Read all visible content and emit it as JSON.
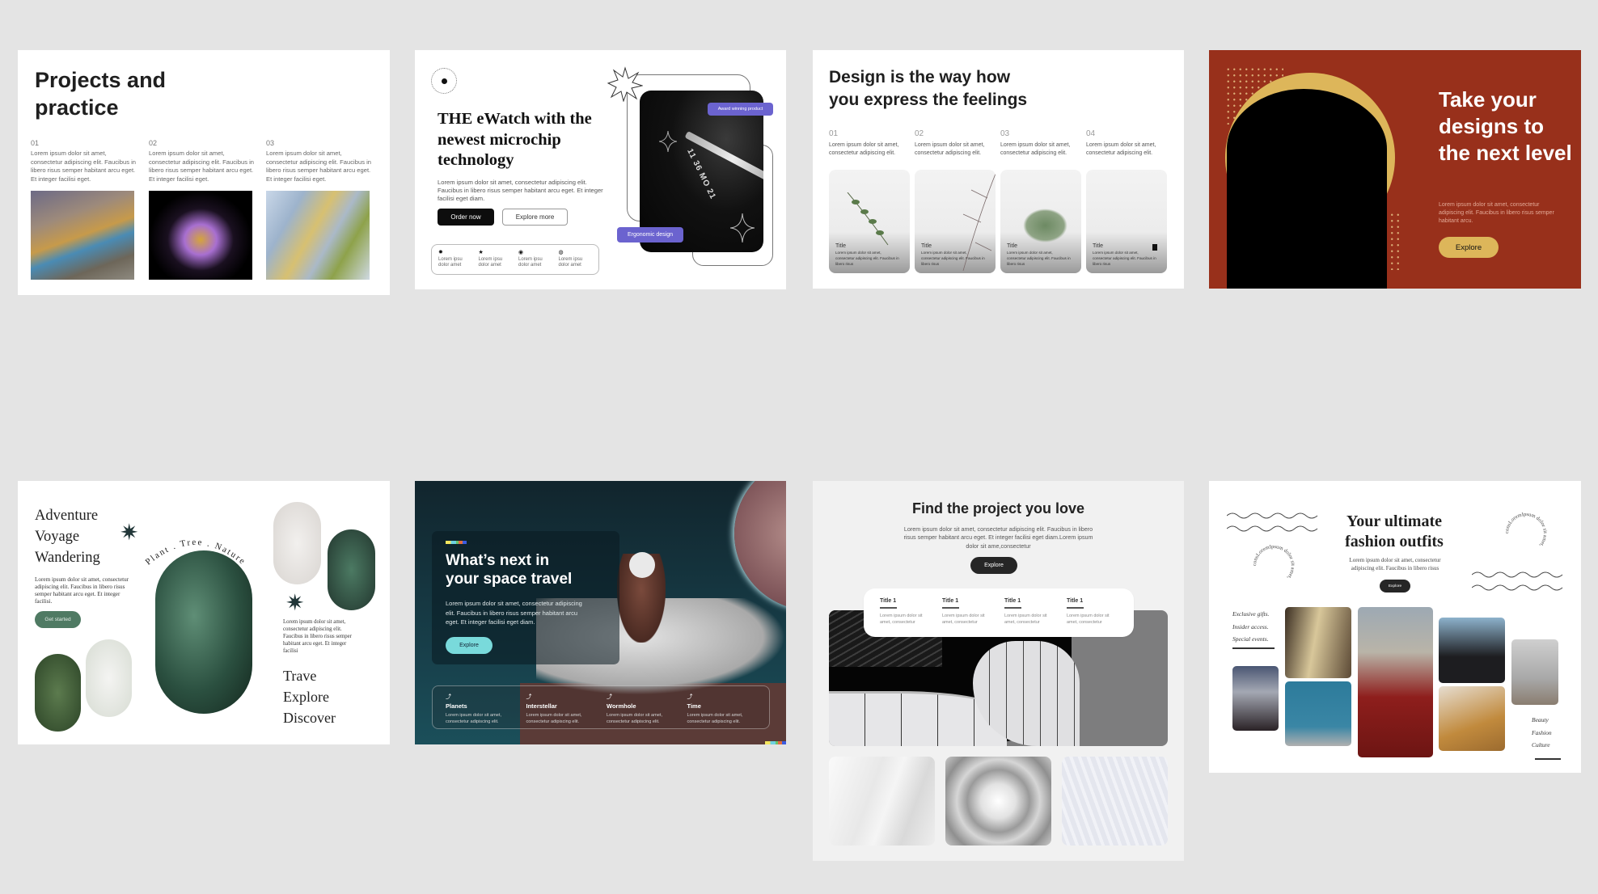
{
  "page": {
    "background": "#e4e4e4"
  },
  "cards": {
    "projects": {
      "title_line1": "Projects and",
      "title_line2": "practice",
      "columns": [
        {
          "number": "01",
          "text": "Lorem ipsum dolor sit amet, consectetur adipiscing elit. Faucibus in libero risus semper habitant arcu eget. Et integer facilisi eget.",
          "image": "iridescent-crumpled-foil"
        },
        {
          "number": "02",
          "text": "Lorem ipsum dolor sit amet, consectetur adipiscing elit. Faucibus in libero risus semper habitant arcu eget. Et integer facilisi eget.",
          "image": "crystal-hand-gold-ring"
        },
        {
          "number": "03",
          "text": "Lorem ipsum dolor sit amet, consectetur adipiscing elit. Faucibus in libero risus semper habitant arcu eget. Et integer facilisi eget.",
          "image": "crystal-shards"
        }
      ]
    },
    "ewatch": {
      "title": "THE eWatch with the newest microchip technology",
      "description": "Lorem ipsum dolor sit amet, consectetur adipiscing elit. Faucibus in libero risus semper habitant arcu eget. Et integer facilisi eget diam.",
      "order_button": "Order now",
      "explore_button": "Explore more",
      "award_tag": "Award winning product",
      "ergonomic_tag": "Ergonomic design",
      "watch_display": "11 36 MO 21",
      "features": [
        {
          "icon": "sun-icon",
          "glyph": "✹",
          "text": "Lorem ipsu dolor amet"
        },
        {
          "icon": "star-icon",
          "glyph": "★",
          "text": "Lorem ipsu dolor amet"
        },
        {
          "icon": "eye-icon",
          "glyph": "◉",
          "text": "Lorem ipsu dolor amet"
        },
        {
          "icon": "globe-icon",
          "glyph": "◍",
          "text": "Lorem ipsu dolor amet"
        }
      ],
      "accent": "#6b63cf"
    },
    "design": {
      "title_line1": "Design is the way how",
      "title_line2": "you express the feelings",
      "columns": [
        {
          "number": "01",
          "text": "Lorem ipsum dolor sit amet, consectetur adipiscing elit.",
          "tile_title": "Title",
          "tile_text": "Lorem ipsum dolor sit amet, consectetur adipiscing elit. Faucibus in libero risus"
        },
        {
          "number": "02",
          "text": "Lorem ipsum dolor sit amet, consectetur adipiscing elit.",
          "tile_title": "Title",
          "tile_text": "Lorem ipsum dolor sit amet, consectetur adipiscing elit. Faucibus in libero risus"
        },
        {
          "number": "03",
          "text": "Lorem ipsum dolor sit amet, consectetur adipiscing elit.",
          "tile_title": "Title",
          "tile_text": "Lorem ipsum dolor sit amet, consectetur adipiscing elit. Faucibus in libero risus"
        },
        {
          "number": "04",
          "text": "Lorem ipsum dolor sit amet, consectetur adipiscing elit.",
          "tile_title": "Title",
          "tile_text": "Lorem ipsum dolor sit amet, consectetur adipiscing elit. Faucibus in libero risus"
        }
      ]
    },
    "next_level": {
      "title": "Take your designs to the next level",
      "description": "Lorem ipsum dolor sit amet, consectetur adipiscing elit. Faucibus in libero risus semper habitant arcu.",
      "button": "Explore",
      "background": "#98301b",
      "accent": "#ddb65a"
    },
    "adventure": {
      "title_lines": [
        "Adventure",
        "Voyage",
        "Wandering"
      ],
      "description": "Lorem ipsum dolor sit amet, consectetur adipiscing elit. Faucibus in libero risus semper habitant arcu eget. Et integer facilisi.",
      "button": "Get started",
      "arc_text": "Plant . Tree . Nature",
      "description2": "Lorem ipsum dolor sit amet, consectetur adipiscing elit. Faucibus in libero risus semper habitant arcu eget. Et integer facilisi",
      "words": [
        "Trave",
        "Explore",
        "Discover"
      ],
      "accent": "#4f7a63"
    },
    "space": {
      "title_line1": "What’s next in",
      "title_line2": "your space travel",
      "description": "Lorem ipsum dolor sit amet, consectetur adipiscing elit. Faucibus in libero risus semper habitant arcu eget. Et integer facilisi eget diam.",
      "button": "Explore",
      "items": [
        {
          "title": "Planets",
          "text": "Lorem ipsum dolor sit amet, consectetur adipiscing elit."
        },
        {
          "title": "Interstellar",
          "text": "Lorem ipsum dolor sit amet, consectetur adipiscing elit."
        },
        {
          "title": "Wormhole",
          "text": "Lorem ipsum dolor sit amet, consectetur adipiscing elit."
        },
        {
          "title": "Time",
          "text": "Lorem ipsum dolor sit amet, consectetur adipiscing elit."
        }
      ],
      "accent": "#79dadb"
    },
    "find_project": {
      "title": "Find the project you love",
      "description": "Lorem ipsum dolor sit amet, consectetur adipiscing elit. Faucibus in libero risus semper habitant arcu eget. Et integer facilisi eget diam.Lorem ipsum dolor sit ame,consectetur",
      "button": "Explore",
      "tabs": [
        {
          "title": "Title 1",
          "text": "Lorem ipsum dolor sit amet, consectetur"
        },
        {
          "title": "Title 1",
          "text": "Lorem ipsum dolor sit amet, consectetur"
        },
        {
          "title": "Title 1",
          "text": "Lorem ipsum dolor sit amet, consectetur"
        },
        {
          "title": "Title 1",
          "text": "Lorem ipsum dolor sit amet, consectetur"
        }
      ]
    },
    "fashion": {
      "title_line1": "Your ultimate",
      "title_line2": "fashion outfits",
      "description": "Lorem ipsum dolor sit amet, consectetur adipiscing elit. Faucibus in libero risus",
      "button": "Explore",
      "ring_text": "consLoremIpsum dolor sit amet,",
      "perks": [
        "Exclusive gifts.",
        "Insider access.",
        "Special events."
      ],
      "tags": [
        "Beauty",
        "Fashion",
        "Culture"
      ]
    }
  }
}
